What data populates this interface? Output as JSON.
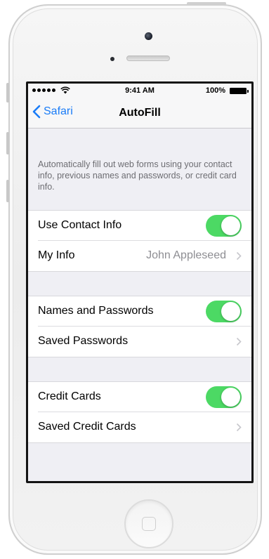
{
  "status_bar": {
    "time": "9:41 AM",
    "battery_percent": "100%",
    "signal_dots": 5
  },
  "nav": {
    "back_label": "Safari",
    "title": "AutoFill"
  },
  "description": "Automatically fill out web forms using your contact info, previous names and passwords, or credit card info.",
  "groups": [
    {
      "rows": [
        {
          "label": "Use Contact Info",
          "type": "toggle",
          "on": true
        },
        {
          "label": "My Info",
          "type": "disclosure",
          "value": "John Appleseed"
        }
      ]
    },
    {
      "rows": [
        {
          "label": "Names and Passwords",
          "type": "toggle",
          "on": true
        },
        {
          "label": "Saved Passwords",
          "type": "disclosure",
          "value": ""
        }
      ]
    },
    {
      "rows": [
        {
          "label": "Credit Cards",
          "type": "toggle",
          "on": true
        },
        {
          "label": "Saved Credit Cards",
          "type": "disclosure",
          "value": ""
        }
      ]
    }
  ],
  "colors": {
    "accent": "#1a7cf7",
    "toggle_on": "#4cd964",
    "background": "#efeff4"
  }
}
